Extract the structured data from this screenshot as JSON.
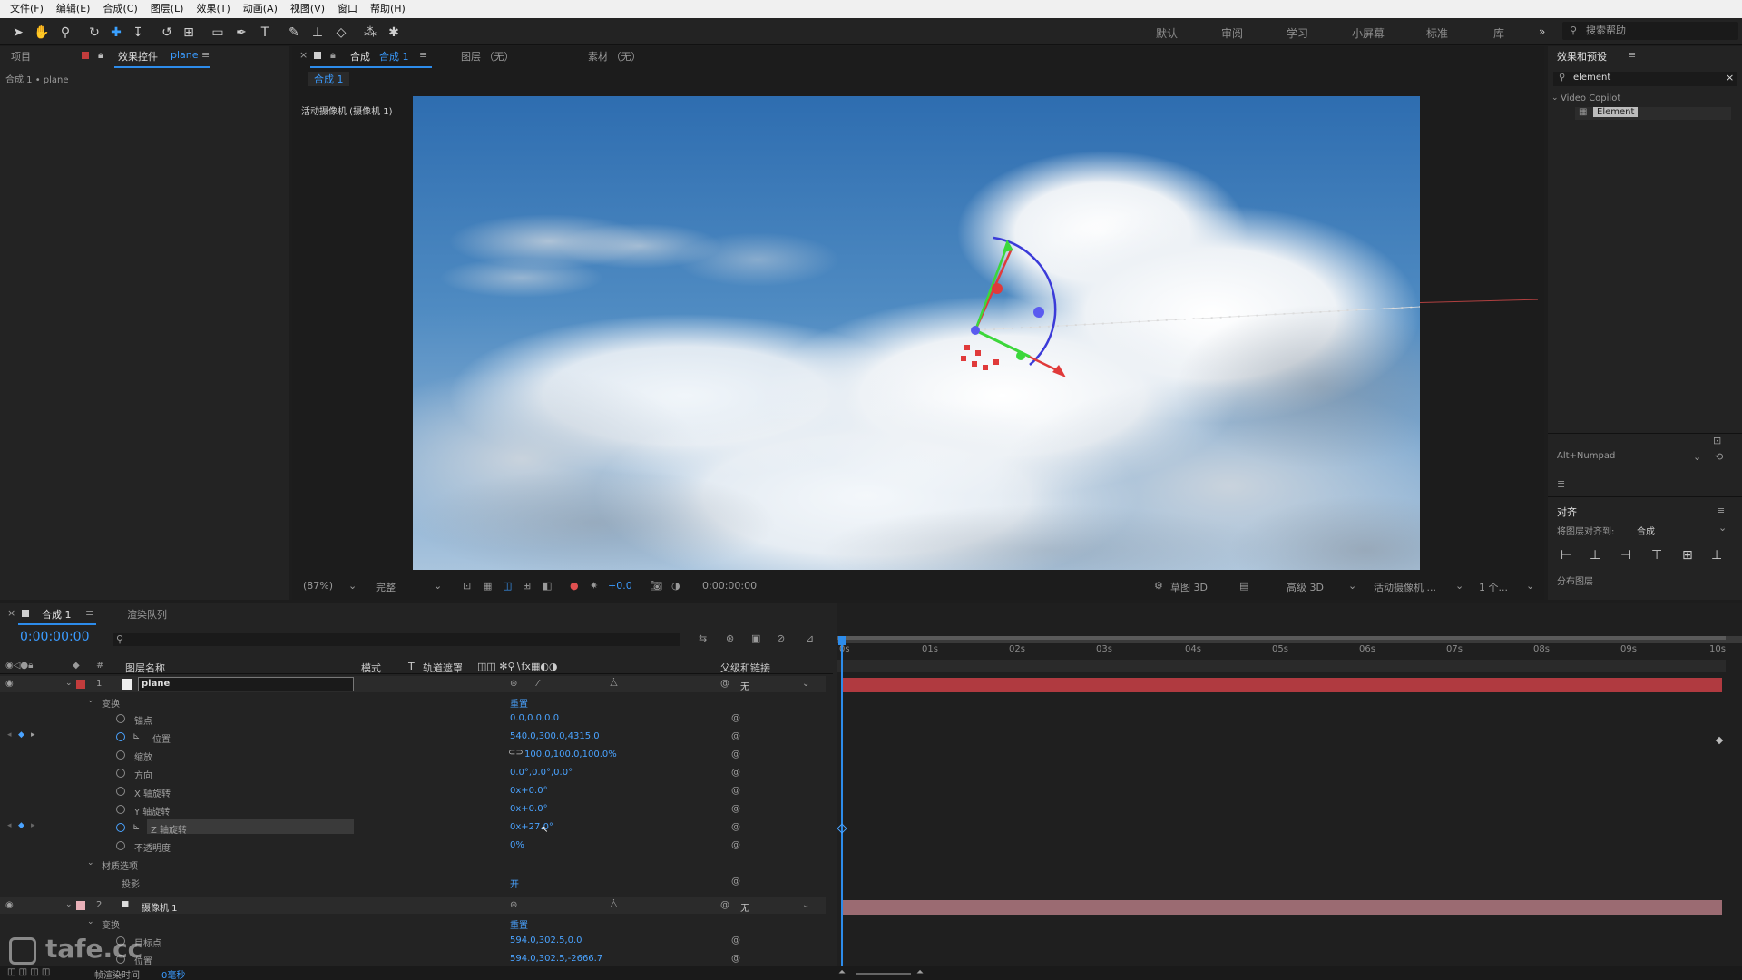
{
  "menu": [
    "文件(F)",
    "编辑(E)",
    "合成(C)",
    "图层(L)",
    "效果(T)",
    "动画(A)",
    "视图(V)",
    "窗口",
    "帮助(H)"
  ],
  "workspaces": [
    "默认",
    "审阅",
    "学习",
    "小屏幕",
    "标准",
    "库"
  ],
  "search_help": "搜索帮助",
  "project": {
    "tab_project": "项目",
    "tab_effects": "效果控件",
    "tab_effects_layer": "plane",
    "breadcrumb": "合成 1 • plane"
  },
  "viewer": {
    "tab_comp_prefix": "合成",
    "tab_comp_name": "合成 1",
    "tab_layer": "图层 （无）",
    "tab_footage": "素材 （无）",
    "subtab": "合成 1",
    "camera_label": "活动摄像机 (摄像机 1)",
    "zoom": "(87%)",
    "quality": "完整",
    "exposure": "+0.0",
    "timecode": "0:00:00:00",
    "renderer": "草图 3D",
    "renderer2": "高级 3D",
    "view": "活动摄像机 ...",
    "views": "1 个..."
  },
  "effects_presets": {
    "title": "效果和预设",
    "search": "element",
    "category": "Video Copilot",
    "item": "Element"
  },
  "right_lower": {
    "numpad": "Alt+Numpad",
    "align_title": "对齐",
    "align_to_label": "将图层对齐到:",
    "align_to_value": "合成",
    "distribute": "分布图层"
  },
  "timeline": {
    "tab_comp": "合成 1",
    "tab_render": "渲染队列",
    "timecode": "0:00:00:00",
    "col_layer_name": "图层名称",
    "col_mode": "模式",
    "col_t": "T",
    "col_trkmat": "轨道遮罩",
    "col_parent": "父级和链接",
    "ticks": [
      "0s",
      "01s",
      "02s",
      "03s",
      "04s",
      "05s",
      "06s",
      "07s",
      "08s",
      "09s",
      "10s"
    ],
    "layer1": {
      "num": "1",
      "name": "plane",
      "parent": "无"
    },
    "transform": "变换",
    "reset": "重置",
    "props": [
      {
        "name": "锚点",
        "value": "0.0,0.0,0.0"
      },
      {
        "name": "位置",
        "value": "540.0,300.0,4315.0"
      },
      {
        "name": "缩放",
        "value": "100.0,100.0,100.0%"
      },
      {
        "name": "方向",
        "value": "0.0°,0.0°,0.0°"
      },
      {
        "name": "X 轴旋转",
        "value": "0x+0.0°"
      },
      {
        "name": "Y 轴旋转",
        "value": "0x+0.0°"
      },
      {
        "name": "Z 轴旋转",
        "value": "0x+27.0°"
      },
      {
        "name": "不透明度",
        "value": "0%"
      }
    ],
    "material": "材质选项",
    "cast": "投影",
    "cast_value": "开",
    "layer2": {
      "num": "2",
      "name": "摄像机 1",
      "parent": "无"
    },
    "transform2": "变换",
    "reset2": "重置",
    "props2": [
      {
        "name": "目标点",
        "value": "594.0,302.5,0.0"
      },
      {
        "name": "位置",
        "value": "594.0,302.5,-2666.7"
      }
    ],
    "render_time_label": "帧渲染时间",
    "render_time_value": "0毫秒",
    "watermark": "tafe.cc"
  },
  "colors": {
    "accent": "#2d8ceb",
    "layer1_bar": "#b03a40",
    "layer2_bar": "#9b6b72",
    "timecode": "#3a9bff"
  }
}
